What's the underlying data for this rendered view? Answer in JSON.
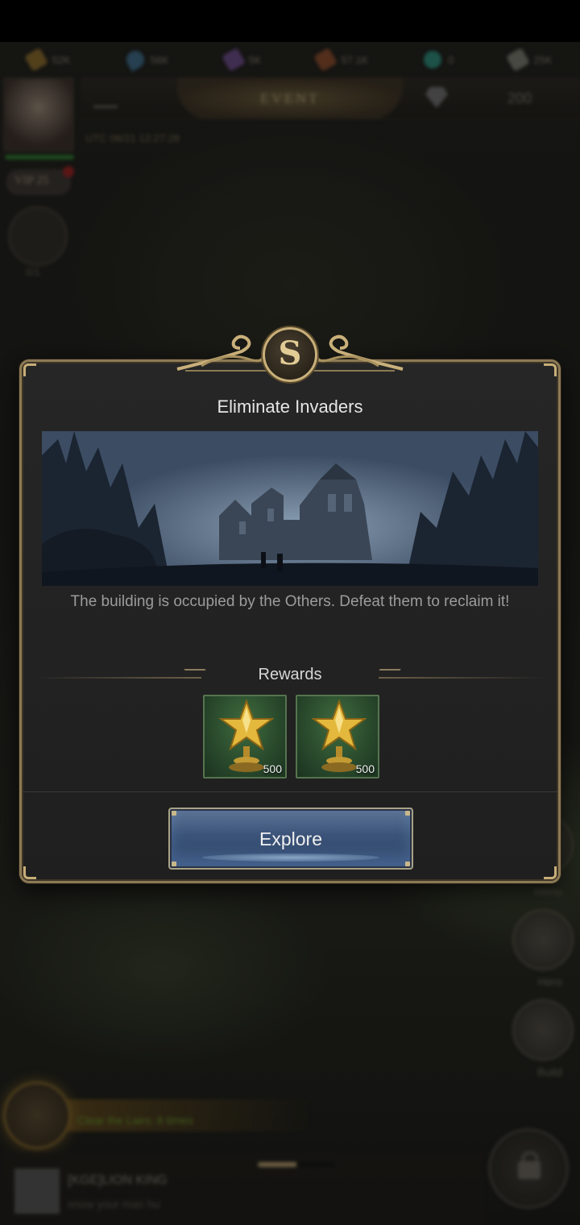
{
  "background": {
    "resources": [
      {
        "icon": "wood-icon",
        "value": "52K",
        "color": "#8a6a2a"
      },
      {
        "icon": "water-icon",
        "value": "56K",
        "color": "#3c6a8a"
      },
      {
        "icon": "crystal-icon",
        "value": "5K",
        "color": "#6a4a8a"
      },
      {
        "icon": "scroll-icon",
        "value": "57.1K",
        "color": "#8a4a2a"
      },
      {
        "icon": "potion-icon",
        "value": "0",
        "color": "#2a8a7a"
      },
      {
        "icon": "steel-icon",
        "value": "25K",
        "color": "#7a7a70"
      }
    ],
    "event_tab_label": "EVENT",
    "gem_count": "200",
    "utc_time": "UTC 06/21 12:27:28",
    "vip_label": "VIP 25",
    "castle_count": "0/1",
    "side_buttons": [
      "Menu",
      "Hero",
      "Build"
    ],
    "quest_text": "Clear the Lairs: 8 times",
    "chat_name": "[KGE]LION KING",
    "chat_message": "snow your man hu"
  },
  "dialog": {
    "crest_letter": "S",
    "title": "Eliminate Invaders",
    "description": "The building is occupied by the Others. Defeat them to reclaim it!",
    "rewards_label": "Rewards",
    "rewards": [
      {
        "icon": "star-trophy-icon",
        "quantity": "500"
      },
      {
        "icon": "star-trophy-icon",
        "quantity": "500"
      }
    ],
    "explore_label": "Explore"
  },
  "colors": {
    "frame_gold": "#8c7a55",
    "button_blue": "#3b5378",
    "reward_green": "#27462a"
  }
}
